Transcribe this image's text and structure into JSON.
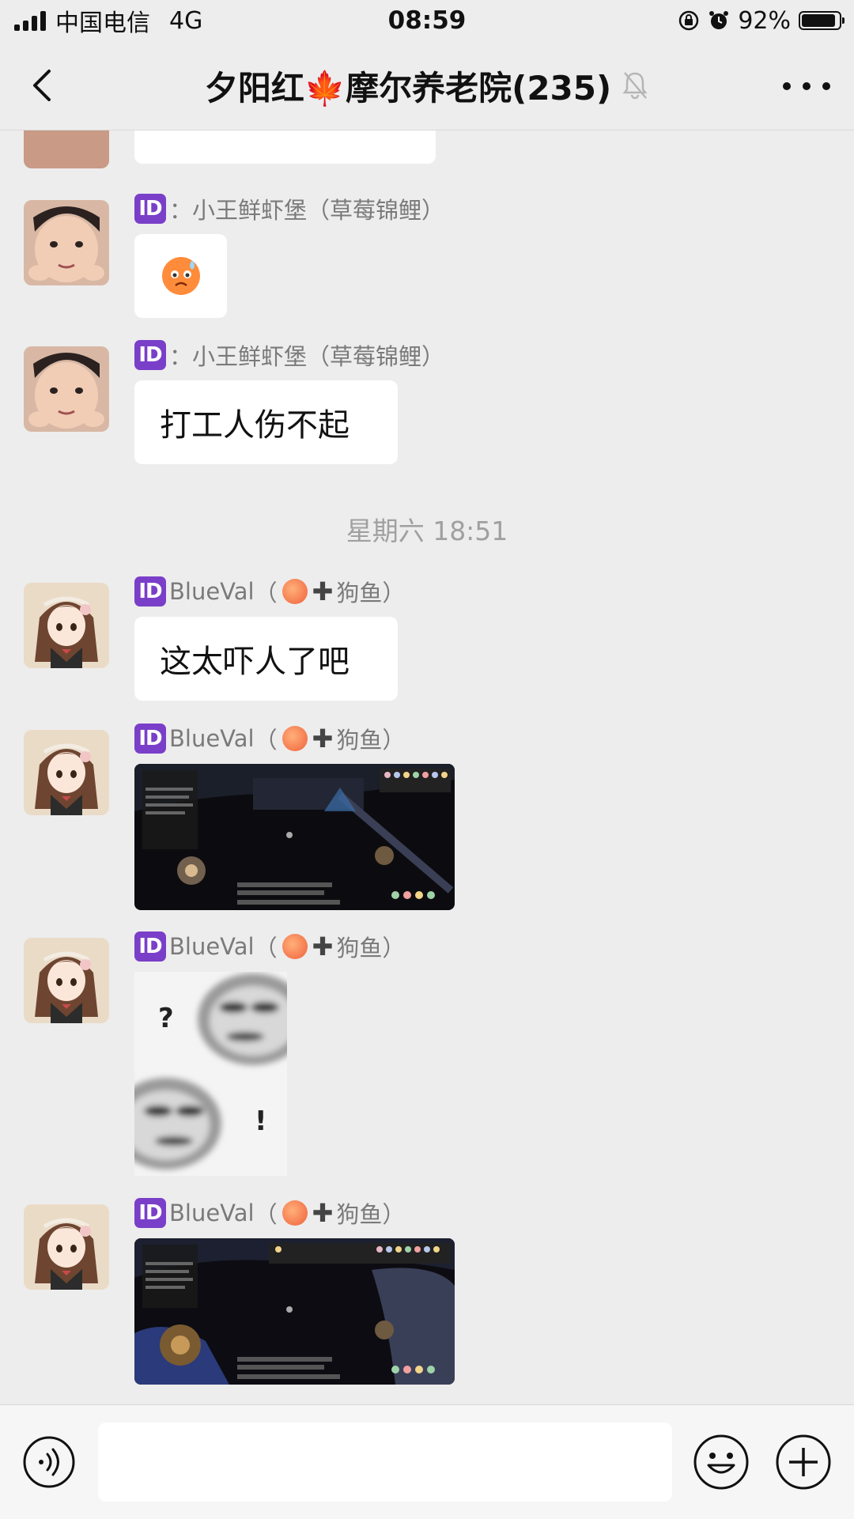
{
  "status_bar": {
    "carrier": "中国电信",
    "network": "4G",
    "time": "08:59",
    "battery_text": "92%",
    "battery_level": 0.92
  },
  "header": {
    "title_left": "夕阳红",
    "title_emoji": "🍁",
    "title_right": "摩尔养老院(235)"
  },
  "messages": {
    "m1": {
      "sender_sep": "：",
      "sender": "小王鲜虾堡（草莓锦鲤）",
      "emoji": "😥"
    },
    "m2": {
      "sender_sep": "：",
      "sender": "小王鲜虾堡（草莓锦鲤）",
      "text": "打工人伤不起"
    },
    "timestamp": "星期六 18:51",
    "m3": {
      "sender_name": "BlueVal",
      "sender_paren_open": "（",
      "sender_suffix": "狗鱼）",
      "text": "这太吓人了吧"
    },
    "m4": {
      "sender_name": "BlueVal",
      "sender_paren_open": "（",
      "sender_suffix": "狗鱼）",
      "image": "game-screenshot"
    },
    "m5": {
      "sender_name": "BlueVal",
      "sender_paren_open": "（",
      "sender_suffix": "狗鱼）",
      "image": "meme-sticker",
      "sticker_text_top": "?",
      "sticker_text_bottom": "!"
    },
    "m6": {
      "sender_name": "BlueVal",
      "sender_paren_open": "（",
      "sender_suffix": "狗鱼）",
      "image": "game-screenshot"
    }
  },
  "badge_text": "ID",
  "colors": {
    "background": "#ededed",
    "bubble": "#ffffff",
    "badge": "#7a3fc9",
    "muted_text": "#7a7a7a"
  },
  "icons": [
    "back-chevron-icon",
    "mute-bell-icon",
    "more-icon",
    "voice-icon",
    "emoji-icon",
    "plus-icon",
    "orientation-lock-icon",
    "alarm-icon"
  ]
}
